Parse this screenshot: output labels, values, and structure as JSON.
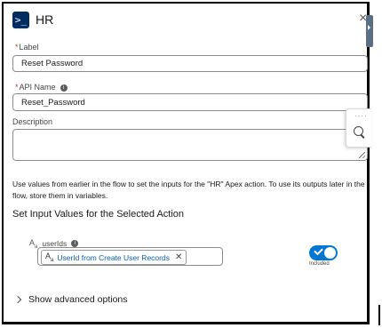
{
  "header": {
    "icon": "terminal-prompt-icon",
    "title": "HR",
    "close_icon": "close-icon"
  },
  "form": {
    "label": {
      "label": "Label",
      "value": "Reset Password"
    },
    "api_name": {
      "label": "API Name",
      "value": "Reset_Password",
      "info_icon": "info-icon"
    },
    "description": {
      "label": "Description",
      "value": ""
    }
  },
  "help_text": "Use values from earlier in the flow to set the inputs for the \"HR\" Apex action. To use its outputs later in the flow, store them in variables.",
  "section_title": "Set Input Values for the Selected Action",
  "input_param": {
    "type_icon": "text-type-icon",
    "name": "userIds",
    "value_pill": "UserId from Create User Records",
    "included": true,
    "included_label": "Included"
  },
  "advanced_toggle": "Show advanced options",
  "colors": {
    "brand": "#0176d3",
    "header_icon_bg": "#032d60",
    "link": "#0b5cab",
    "required": "#c23934"
  }
}
